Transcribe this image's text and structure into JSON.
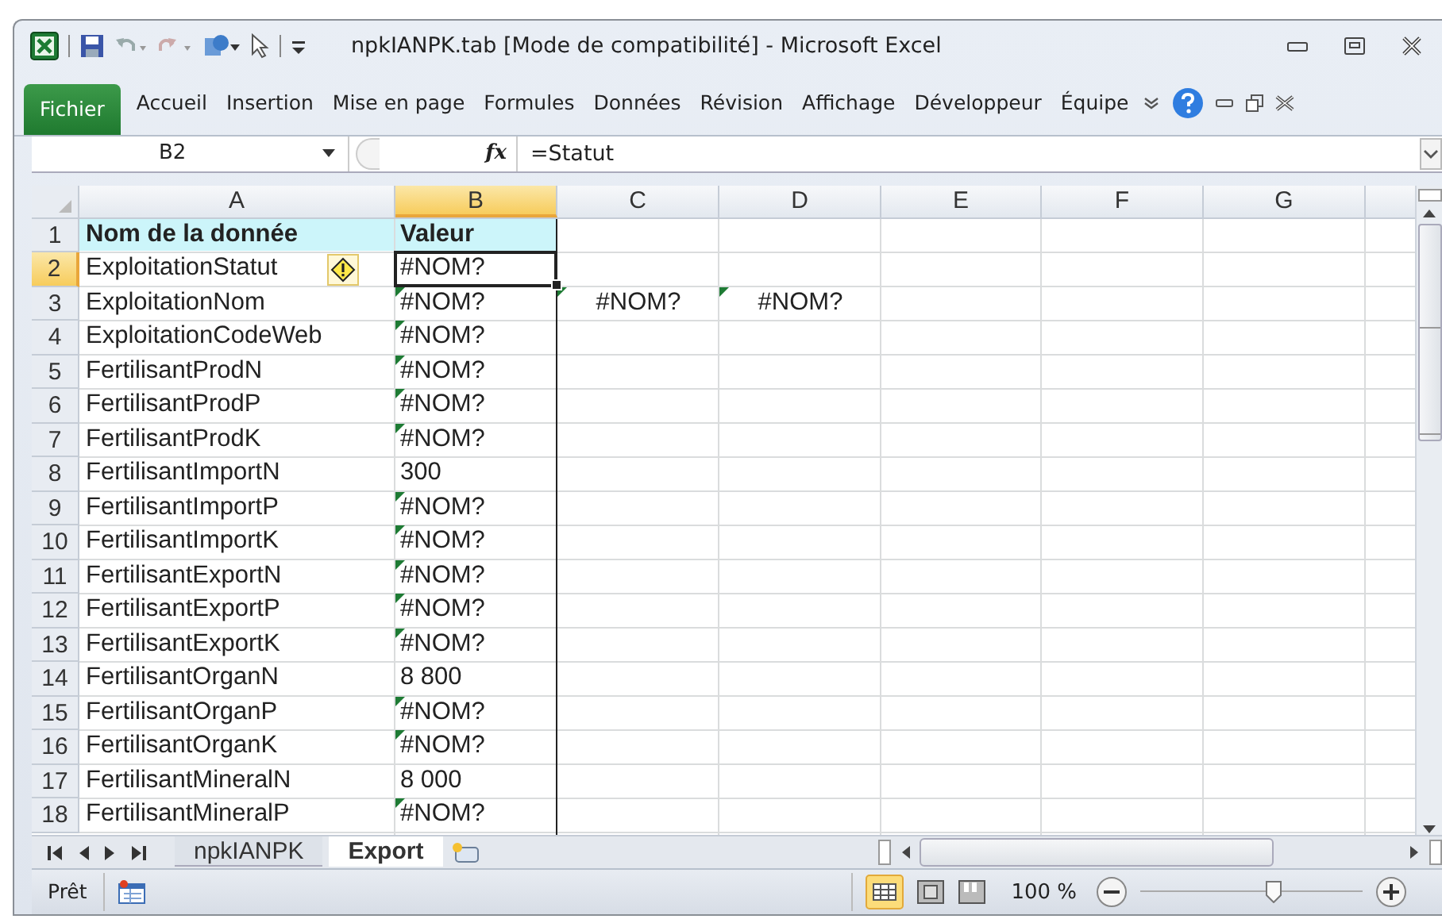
{
  "window": {
    "title": "npkIANPK.tab  [Mode de compatibilité]  -  Microsoft Excel"
  },
  "ribbon_tabs": [
    {
      "label": "Fichier",
      "selected": true
    },
    {
      "label": "Accueil",
      "selected": false
    },
    {
      "label": "Insertion",
      "selected": false
    },
    {
      "label": "Mise en page",
      "selected": false
    },
    {
      "label": "Formules",
      "selected": false
    },
    {
      "label": "Données",
      "selected": false
    },
    {
      "label": "Révision",
      "selected": false
    },
    {
      "label": "Affichage",
      "selected": false
    },
    {
      "label": "Développeur",
      "selected": false
    },
    {
      "label": "Équipe",
      "selected": false
    }
  ],
  "formula_bar": {
    "name_box": "B2",
    "formula": "=Statut",
    "fx": "fx"
  },
  "columns": [
    {
      "label": "A",
      "selected": false
    },
    {
      "label": "B",
      "selected": true
    },
    {
      "label": "C",
      "selected": false
    },
    {
      "label": "D",
      "selected": false
    },
    {
      "label": "E",
      "selected": false
    },
    {
      "label": "F",
      "selected": false
    },
    {
      "label": "G",
      "selected": false
    }
  ],
  "rows": [
    {
      "num": "1",
      "kind": "header",
      "selected": false,
      "name": "Nom de la donnée",
      "value": "Valeur"
    },
    {
      "num": "2",
      "kind": "data",
      "selected": true,
      "name": "ExploitationStatut",
      "value": "#NOM?",
      "flagged": false,
      "smart_tag": true
    },
    {
      "num": "3",
      "kind": "data",
      "selected": false,
      "name": "ExploitationNom",
      "value": "#NOM?",
      "flagged": true,
      "extra": [
        {
          "text": "#NOM?",
          "flagged": true
        },
        {
          "text": "#NOM?",
          "flagged": true
        }
      ]
    },
    {
      "num": "4",
      "kind": "data",
      "selected": false,
      "name": "ExploitationCodeWeb",
      "value": "#NOM?",
      "flagged": true
    },
    {
      "num": "5",
      "kind": "data",
      "selected": false,
      "name": "FertilisantProdN",
      "value": "#NOM?",
      "flagged": true
    },
    {
      "num": "6",
      "kind": "data",
      "selected": false,
      "name": "FertilisantProdP",
      "value": "#NOM?",
      "flagged": true
    },
    {
      "num": "7",
      "kind": "data",
      "selected": false,
      "name": "FertilisantProdK",
      "value": "#NOM?",
      "flagged": true
    },
    {
      "num": "8",
      "kind": "data",
      "selected": false,
      "name": "FertilisantImportN",
      "value": "300",
      "flagged": false
    },
    {
      "num": "9",
      "kind": "data",
      "selected": false,
      "name": "FertilisantImportP",
      "value": "#NOM?",
      "flagged": true
    },
    {
      "num": "10",
      "kind": "data",
      "selected": false,
      "name": "FertilisantImportK",
      "value": "#NOM?",
      "flagged": true
    },
    {
      "num": "11",
      "kind": "data",
      "selected": false,
      "name": "FertilisantExportN",
      "value": "#NOM?",
      "flagged": true
    },
    {
      "num": "12",
      "kind": "data",
      "selected": false,
      "name": "FertilisantExportP",
      "value": "#NOM?",
      "flagged": true
    },
    {
      "num": "13",
      "kind": "data",
      "selected": false,
      "name": "FertilisantExportK",
      "value": "#NOM?",
      "flagged": true
    },
    {
      "num": "14",
      "kind": "data",
      "selected": false,
      "name": "FertilisantOrganN",
      "value": "8 800",
      "flagged": false
    },
    {
      "num": "15",
      "kind": "data",
      "selected": false,
      "name": "FertilisantOrganP",
      "value": "#NOM?",
      "flagged": true
    },
    {
      "num": "16",
      "kind": "data",
      "selected": false,
      "name": "FertilisantOrganK",
      "value": "#NOM?",
      "flagged": true
    },
    {
      "num": "17",
      "kind": "data",
      "selected": false,
      "name": "FertilisantMineralN",
      "value": "8 000",
      "flagged": false
    },
    {
      "num": "18",
      "kind": "data",
      "selected": false,
      "name": "FertilisantMineralP",
      "value": "#NOM?",
      "flagged": true
    }
  ],
  "sheet_tabs": [
    {
      "label": "npkIANPK",
      "selected": false
    },
    {
      "label": "Export",
      "selected": true
    }
  ],
  "status_bar": {
    "status": "Prêt",
    "zoom": "100 %"
  },
  "zoom_slider": {
    "level": 0.6
  }
}
